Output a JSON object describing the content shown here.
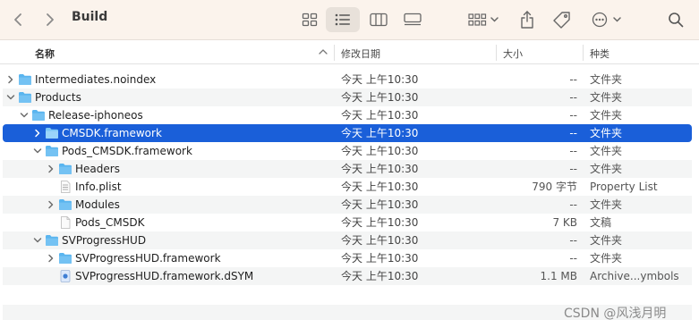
{
  "window": {
    "title": "Build"
  },
  "toolbar": {
    "icons": [
      "chevron-left-icon",
      "chevron-right-icon",
      "icon-view-icon",
      "list-view-icon",
      "column-view-icon",
      "gallery-view-icon",
      "group-icon",
      "share-icon",
      "tag-icon",
      "more-icon",
      "search-icon"
    ]
  },
  "columns": {
    "name": "名称",
    "date": "修改日期",
    "size": "大小",
    "kind": "种类"
  },
  "rows": [
    {
      "name": "Intermediates.noindex",
      "date": "今天 上午10:30",
      "size": "--",
      "kind": "文件夹",
      "depth": 0,
      "disclosure": "collapsed",
      "icon": "folder-icon"
    },
    {
      "name": "Products",
      "date": "今天 上午10:30",
      "size": "--",
      "kind": "文件夹",
      "depth": 0,
      "disclosure": "expanded",
      "icon": "folder-icon"
    },
    {
      "name": "Release-iphoneos",
      "date": "今天 上午10:30",
      "size": "--",
      "kind": "文件夹",
      "depth": 1,
      "disclosure": "expanded",
      "icon": "folder-icon"
    },
    {
      "name": "CMSDK.framework",
      "date": "今天 上午10:30",
      "size": "--",
      "kind": "文件夹",
      "depth": 2,
      "disclosure": "collapsed",
      "icon": "folder-icon",
      "selected": true
    },
    {
      "name": "Pods_CMSDK.framework",
      "date": "今天 上午10:30",
      "size": "--",
      "kind": "文件夹",
      "depth": 2,
      "disclosure": "expanded",
      "icon": "folder-icon"
    },
    {
      "name": "Headers",
      "date": "今天 上午10:30",
      "size": "--",
      "kind": "文件夹",
      "depth": 3,
      "disclosure": "collapsed",
      "icon": "folder-icon"
    },
    {
      "name": "Info.plist",
      "date": "今天 上午10:30",
      "size": "790 字节",
      "kind": "Property List",
      "depth": 3,
      "disclosure": "none",
      "icon": "plist-file-icon"
    },
    {
      "name": "Modules",
      "date": "今天 上午10:30",
      "size": "--",
      "kind": "文件夹",
      "depth": 3,
      "disclosure": "collapsed",
      "icon": "folder-icon"
    },
    {
      "name": "Pods_CMSDK",
      "date": "今天 上午10:30",
      "size": "7 KB",
      "kind": "文稿",
      "depth": 3,
      "disclosure": "none",
      "icon": "document-icon"
    },
    {
      "name": "SVProgressHUD",
      "date": "今天 上午10:30",
      "size": "--",
      "kind": "文件夹",
      "depth": 2,
      "disclosure": "expanded",
      "icon": "folder-icon"
    },
    {
      "name": "SVProgressHUD.framework",
      "date": "今天 上午10:30",
      "size": "--",
      "kind": "文件夹",
      "depth": 3,
      "disclosure": "collapsed",
      "icon": "folder-icon"
    },
    {
      "name": "SVProgressHUD.framework.dSYM",
      "date": "今天 上午10:30",
      "size": "1.1 MB",
      "kind": "Archive...ymbols",
      "depth": 3,
      "disclosure": "none",
      "icon": "dsym-archive-icon"
    }
  ],
  "watermark": "CSDN @风浅月明",
  "colors": {
    "selection": "#1a5fd9",
    "folder": "#4fb0f0",
    "toolbar_bg": "#fbf3ec"
  }
}
